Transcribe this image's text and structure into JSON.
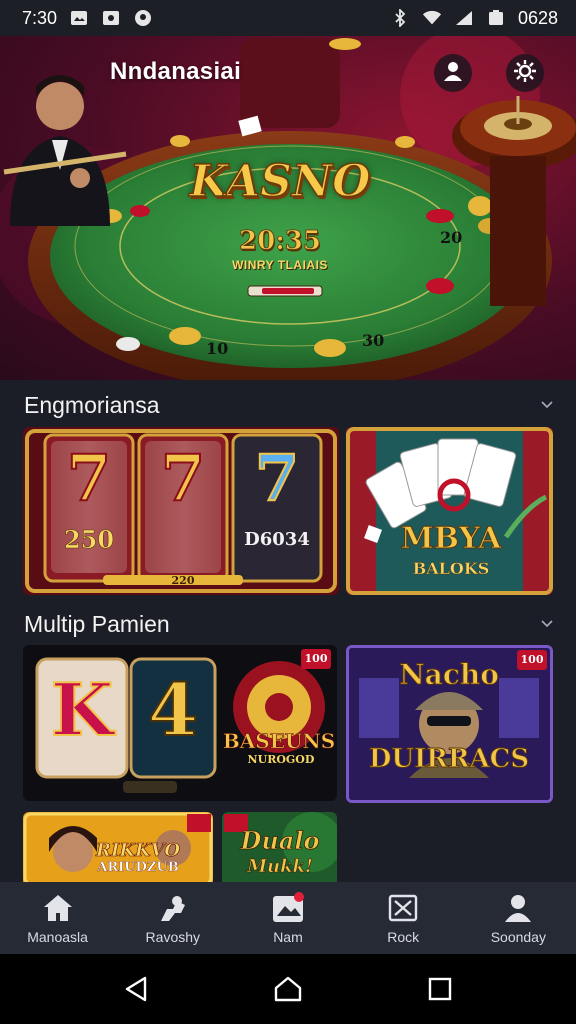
{
  "status_bar": {
    "time": "7:30",
    "clock": "0628",
    "icons": [
      "image-icon",
      "photo-icon",
      "location-icon",
      "bluetooth-icon",
      "wifi-icon",
      "signal-icon",
      "battery-icon"
    ]
  },
  "header": {
    "title": "Nndanasiai",
    "account_icon": "person-icon",
    "settings_icon": "gear-icon"
  },
  "hero": {
    "logo": "KASNO",
    "jackpot": "20:35",
    "jackpot_caption": "WINRY TLAIAIS",
    "table_numbers": [
      "20",
      "10",
      "30"
    ]
  },
  "section_1": {
    "title": "Engmoriansa",
    "cards": [
      {
        "name": "slot-777",
        "reels": [
          "7",
          "7",
          "7"
        ],
        "values": [
          "250",
          "D6034"
        ],
        "bottom": "220"
      },
      {
        "name": "mbya-baloks",
        "title": "MBYA",
        "subtitle": "BALOKS"
      }
    ]
  },
  "section_2": {
    "title": "Multip Pamien",
    "cards": [
      {
        "name": "k4-baseuns",
        "reels": [
          "K",
          "4"
        ],
        "title": "BASEUNS",
        "subtitle": "NUROGOD",
        "badge": "100"
      },
      {
        "name": "nacho-duirracs",
        "title": "Nacho",
        "subtitle": "DUIRRACS",
        "badge": "100"
      },
      {
        "name": "rikkvo",
        "title": "RIKKVO",
        "subtitle": "ARIUDZUB"
      },
      {
        "name": "dualo-muhk",
        "title": "Dualo",
        "subtitle": "Mukk!"
      }
    ]
  },
  "bottom_nav": [
    {
      "label": "Manoasla",
      "icon": "home-icon"
    },
    {
      "label": "Ravoshy",
      "icon": "favorites-icon"
    },
    {
      "label": "Nam",
      "icon": "gallery-icon"
    },
    {
      "label": "Rock",
      "icon": "scratch-icon"
    },
    {
      "label": "Soonday",
      "icon": "profile-icon"
    }
  ],
  "colors": {
    "background": "#1b1e26",
    "nav_background": "#252a35",
    "felt": "#2f8a3a",
    "gold": "#f1c44a",
    "accent_red": "#c0102a"
  }
}
